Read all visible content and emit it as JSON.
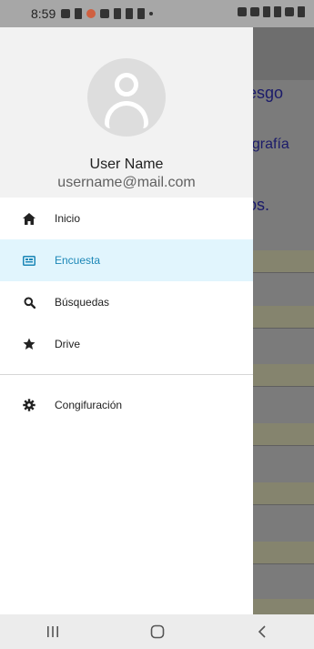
{
  "status_bar": {
    "time": "8:59"
  },
  "background_app": {
    "texts": [
      "iesgo",
      "ografía",
      "los."
    ]
  },
  "drawer": {
    "user": {
      "name": "User Name",
      "email": "username@mail.com"
    },
    "items": [
      {
        "label": "Inicio",
        "icon": "home-icon",
        "selected": false
      },
      {
        "label": "Encuesta",
        "icon": "survey-icon",
        "selected": true
      },
      {
        "label": "Búsquedas",
        "icon": "search-icon",
        "selected": false
      },
      {
        "label": "Drive",
        "icon": "star-icon",
        "selected": false
      }
    ],
    "settings_item": {
      "label": "Congifuración",
      "icon": "gear-icon"
    }
  },
  "nav_bar": {
    "buttons": [
      "recent-apps",
      "home",
      "back"
    ]
  },
  "colors": {
    "selected_bg": "#e1f5fd",
    "selected_text": "#1c87b7",
    "header_bg": "#f2f2f2"
  }
}
